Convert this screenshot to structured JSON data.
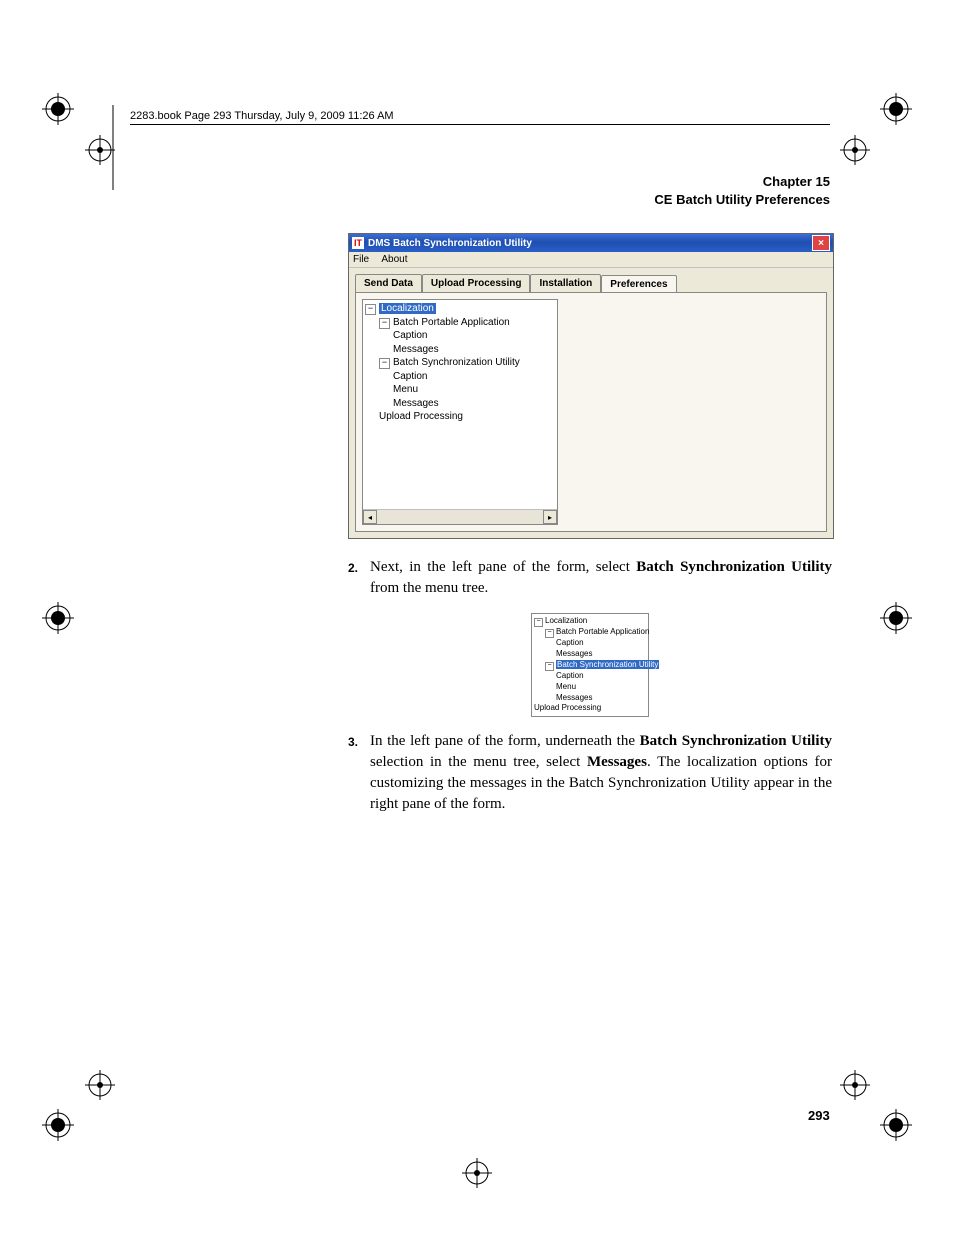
{
  "book_header": "2283.book  Page 293  Thursday, July 9, 2009  11:26 AM",
  "chapter": {
    "line1": "Chapter 15",
    "line2": "CE Batch Utility Preferences"
  },
  "window": {
    "title": "DMS Batch Synchronization Utility",
    "menu": {
      "file": "File",
      "about": "About"
    },
    "tabs": {
      "send_data": "Send Data",
      "upload_processing": "Upload Processing",
      "installation": "Installation",
      "preferences": "Preferences"
    }
  },
  "tree1": {
    "localization": "Localization",
    "bpa": "Batch Portable Application",
    "caption": "Caption",
    "messages": "Messages",
    "bsu": "Batch Synchronization Utility",
    "menu": "Menu",
    "upload": "Upload Processing"
  },
  "step2": {
    "num": "2.",
    "pre": "Next, in the left pane of the form, select ",
    "bold": "Batch Synchronization Utility",
    "post": " from the menu tree."
  },
  "tree2": {
    "localization": "Localization",
    "bpa": "Batch Portable Application",
    "caption": "Caption",
    "messages": "Messages",
    "bsu": "Batch Synchronization Utility",
    "menu": "Menu",
    "upload": "Upload Processing"
  },
  "step3": {
    "num": "3.",
    "t1": "In the left pane of the form, underneath the ",
    "b1": "Batch Synchronization Utility",
    "t2": " selection in the menu tree, select ",
    "b2": "Messages",
    "t3": ". The localization options for customizing the messages in the Batch Synchronization Utility appear in the right pane of the form."
  },
  "page_number": "293"
}
